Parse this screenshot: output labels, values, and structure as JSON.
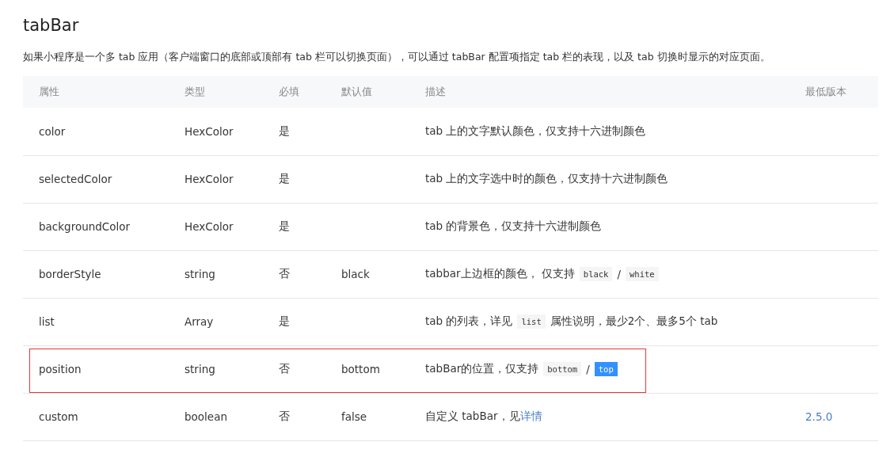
{
  "title": "tabBar",
  "intro": "如果小程序是一个多 tab 应用（客户端窗口的底部或顶部有 tab 栏可以切换页面），可以通过 tabBar 配置项指定 tab 栏的表现，以及 tab 切换时显示的对应页面。",
  "table": {
    "columns": [
      "属性",
      "类型",
      "必填",
      "默认值",
      "描述",
      "最低版本"
    ],
    "rows": [
      {
        "name": "color",
        "type": "HexColor",
        "required": "是",
        "default": "",
        "description": [
          {
            "kind": "text",
            "text": "tab 上的文字默认颜色，仅支持十六进制颜色"
          }
        ],
        "version": "",
        "highlighted": false
      },
      {
        "name": "selectedColor",
        "type": "HexColor",
        "required": "是",
        "default": "",
        "description": [
          {
            "kind": "text",
            "text": "tab 上的文字选中时的颜色，仅支持十六进制颜色"
          }
        ],
        "version": "",
        "highlighted": false
      },
      {
        "name": "backgroundColor",
        "type": "HexColor",
        "required": "是",
        "default": "",
        "description": [
          {
            "kind": "text",
            "text": "tab 的背景色，仅支持十六进制颜色"
          }
        ],
        "version": "",
        "highlighted": false
      },
      {
        "name": "borderStyle",
        "type": "string",
        "required": "否",
        "default": "black",
        "description": [
          {
            "kind": "text",
            "text": "tabbar上边框的颜色， 仅支持"
          },
          {
            "kind": "code",
            "text": "black",
            "selected": false
          },
          {
            "kind": "text",
            "text": "/"
          },
          {
            "kind": "code",
            "text": "white",
            "selected": false
          }
        ],
        "version": "",
        "highlighted": false
      },
      {
        "name": "list",
        "type": "Array",
        "required": "是",
        "default": "",
        "description": [
          {
            "kind": "text",
            "text": "tab 的列表，详见"
          },
          {
            "kind": "code",
            "text": "list",
            "selected": false
          },
          {
            "kind": "text",
            "text": "属性说明，最少2个、最多5个 tab"
          }
        ],
        "version": "",
        "highlighted": false
      },
      {
        "name": "position",
        "type": "string",
        "required": "否",
        "default": "bottom",
        "description": [
          {
            "kind": "text",
            "text": "tabBar的位置，仅支持"
          },
          {
            "kind": "code",
            "text": "bottom",
            "selected": false
          },
          {
            "kind": "text",
            "text": "/"
          },
          {
            "kind": "code",
            "text": "top",
            "selected": true
          }
        ],
        "version": "",
        "highlighted": true
      },
      {
        "name": "custom",
        "type": "boolean",
        "required": "否",
        "default": "false",
        "description": [
          {
            "kind": "text",
            "text": "自定义 tabBar，见"
          },
          {
            "kind": "link",
            "text": "详情"
          }
        ],
        "version": "2.5.0",
        "highlighted": false
      }
    ]
  }
}
